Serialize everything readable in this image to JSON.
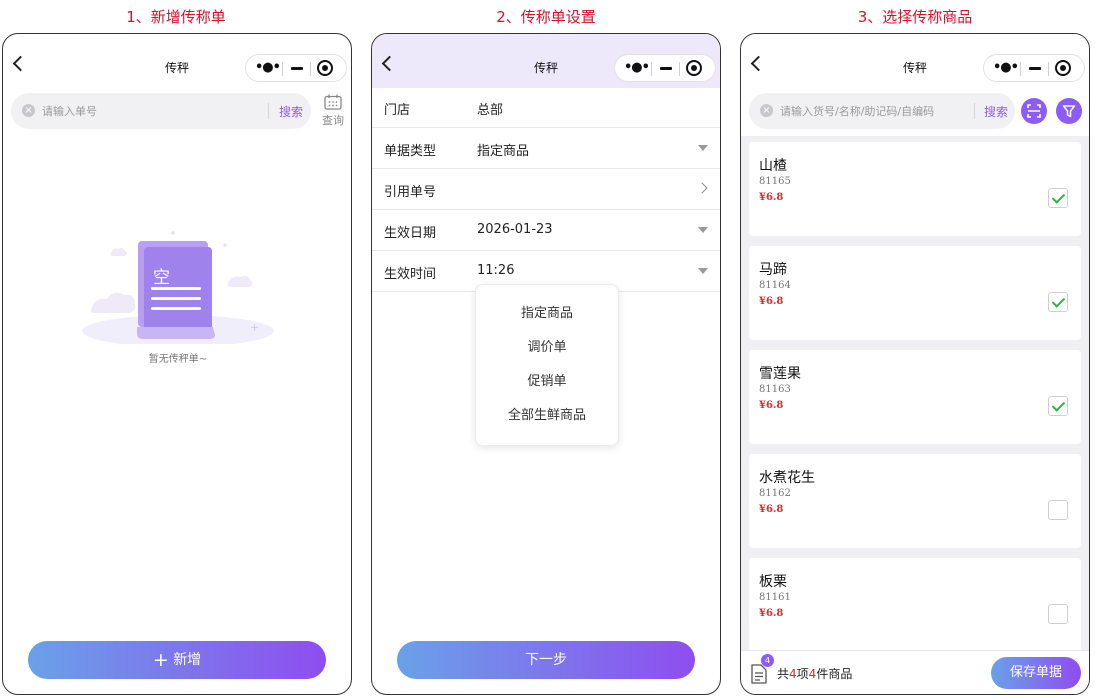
{
  "steps": [
    {
      "title": "1、新增传称单"
    },
    {
      "title": "2、传称单设置"
    },
    {
      "title": "3、选择传称商品"
    }
  ],
  "screen1": {
    "nav_title": "传秤",
    "search_placeholder": "请输入单号",
    "search_button": "搜索",
    "query_label": "查询",
    "empty_glyph": "空",
    "empty_text": "暂无传秤单~",
    "add_button": "新增"
  },
  "screen2": {
    "nav_title": "传秤",
    "rows": [
      {
        "label": "门店",
        "value": "总部",
        "control": "none"
      },
      {
        "label": "单据类型",
        "value": "指定商品",
        "control": "dropdown"
      },
      {
        "label": "引用单号",
        "value": "",
        "control": "chevron"
      },
      {
        "label": "生效日期",
        "value": "2026-01-23",
        "control": "dropdown"
      },
      {
        "label": "生效时间",
        "value": "11:26",
        "control": "dropdown"
      }
    ],
    "dropdown_options": [
      "指定商品",
      "调价单",
      "促销单",
      "全部生鲜商品"
    ],
    "next_button": "下一步"
  },
  "screen3": {
    "nav_title": "传秤",
    "search_placeholder": "请输入货号/名称/助记码/自编码",
    "search_button": "搜索",
    "products": [
      {
        "name": "山楂",
        "code": "81165",
        "price": "¥6.8",
        "checked": true
      },
      {
        "name": "马蹄",
        "code": "81164",
        "price": "¥6.8",
        "checked": true
      },
      {
        "name": "雪莲果",
        "code": "81163",
        "price": "¥6.8",
        "checked": true
      },
      {
        "name": "水煮花生",
        "code": "81162",
        "price": "¥6.8",
        "checked": false
      },
      {
        "name": "板栗",
        "code": "81161",
        "price": "¥6.8",
        "checked": false
      }
    ],
    "badge_count": "4",
    "summary": {
      "prefix": "共",
      "items": "4",
      "mid": "项",
      "pieces": "4",
      "suffix": "件商品"
    },
    "save_button": "保存单据"
  },
  "colors": {
    "accent": "#8b5cf6",
    "step_title": "#d9122c",
    "price": "#e0282e",
    "check": "#2fb344",
    "screen2_header_bg": "#ede9fb"
  }
}
